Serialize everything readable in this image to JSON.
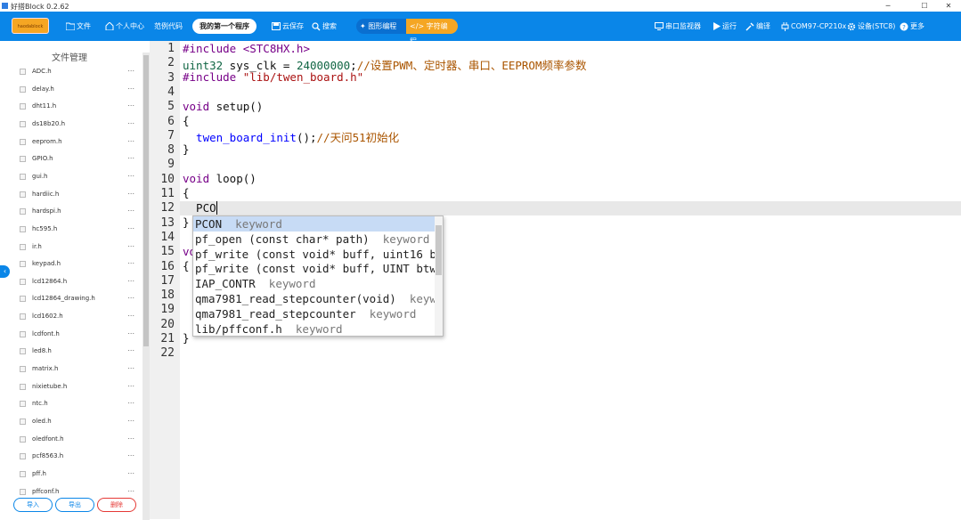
{
  "window": {
    "title": "好搭Block 0.2.62",
    "minimize": "─",
    "maximize": "☐",
    "close": "✕"
  },
  "toolbar": {
    "logo_text": "haodablock",
    "file": "文件",
    "profile": "个人中心",
    "examples": "范例代码",
    "program_name": "我的第一个程序",
    "cloud_save": "云保存",
    "search": "搜索",
    "graphic_mode": "图形编程",
    "text_mode": "字符编程",
    "serial_monitor": "串口监视器",
    "run": "运行",
    "compile": "编译",
    "port": "COM97-CP210x",
    "device": "设备(STC8)",
    "more": "更多",
    "accent": "#0a86e8"
  },
  "sidebar": {
    "title": "文件管理",
    "files": [
      "ADC.h",
      "delay.h",
      "dht11.h",
      "ds18b20.h",
      "eeprom.h",
      "GPIO.h",
      "gui.h",
      "hardiic.h",
      "hardspi.h",
      "hc595.h",
      "ir.h",
      "keypad.h",
      "lcd12864.h",
      "lcd12864_drawing.h",
      "lcd1602.h",
      "lcdfont.h",
      "led8.h",
      "matrix.h",
      "nixietube.h",
      "ntc.h",
      "oled.h",
      "oledfont.h",
      "pcf8563.h",
      "pff.h",
      "pffconf.h"
    ],
    "more": "...",
    "import": "导入",
    "export": "导出",
    "delete": "删除",
    "collapse": "‹"
  },
  "editor": {
    "line_numbers": [
      "1",
      "2",
      "3",
      "4",
      "5",
      "6",
      "7",
      "8",
      "9",
      "10",
      "11",
      "12",
      "13",
      "14",
      "15",
      "16",
      "17",
      "18",
      "19",
      "20",
      "21",
      "22"
    ],
    "l1": "#include <STC8HX.h>",
    "l2a": "uint32",
    "l2b": " sys_clk = ",
    "l2c": "24000000",
    "l2d": ";",
    "l2e": "//设置PWM、定时器、串口、EEPROM频率参数",
    "l3a": "#include ",
    "l3b": "\"lib/twen_board.h\"",
    "l5a": "void",
    "l5b": " setup()",
    "l6": "{",
    "l7a": "  twen_board_init",
    "l7b": "();",
    "l7c": "//天问51初始化",
    "l8": "}",
    "l10a": "void",
    "l10b": " loop()",
    "l11": "{",
    "l12": "  PCO",
    "l13": "}",
    "l15": "vo",
    "l16": "{",
    "l21": "}"
  },
  "autocomplete": [
    {
      "name": "PCON",
      "kind": "keyword"
    },
    {
      "name": "pf_open (const char* path)",
      "kind": "keyword"
    },
    {
      "name": "pf_write (const void* buff, uint16 b",
      "kind": ""
    },
    {
      "name": "pf_write (const void* buff, UINT btw",
      "kind": ""
    },
    {
      "name": "IAP_CONTR",
      "kind": "keyword"
    },
    {
      "name": "qma7981_read_stepcounter(void)",
      "kind": "keywo"
    },
    {
      "name": "qma7981_read_stepcounter",
      "kind": "keyword"
    },
    {
      "name": "lib/pffconf.h",
      "kind": "keyword"
    }
  ]
}
